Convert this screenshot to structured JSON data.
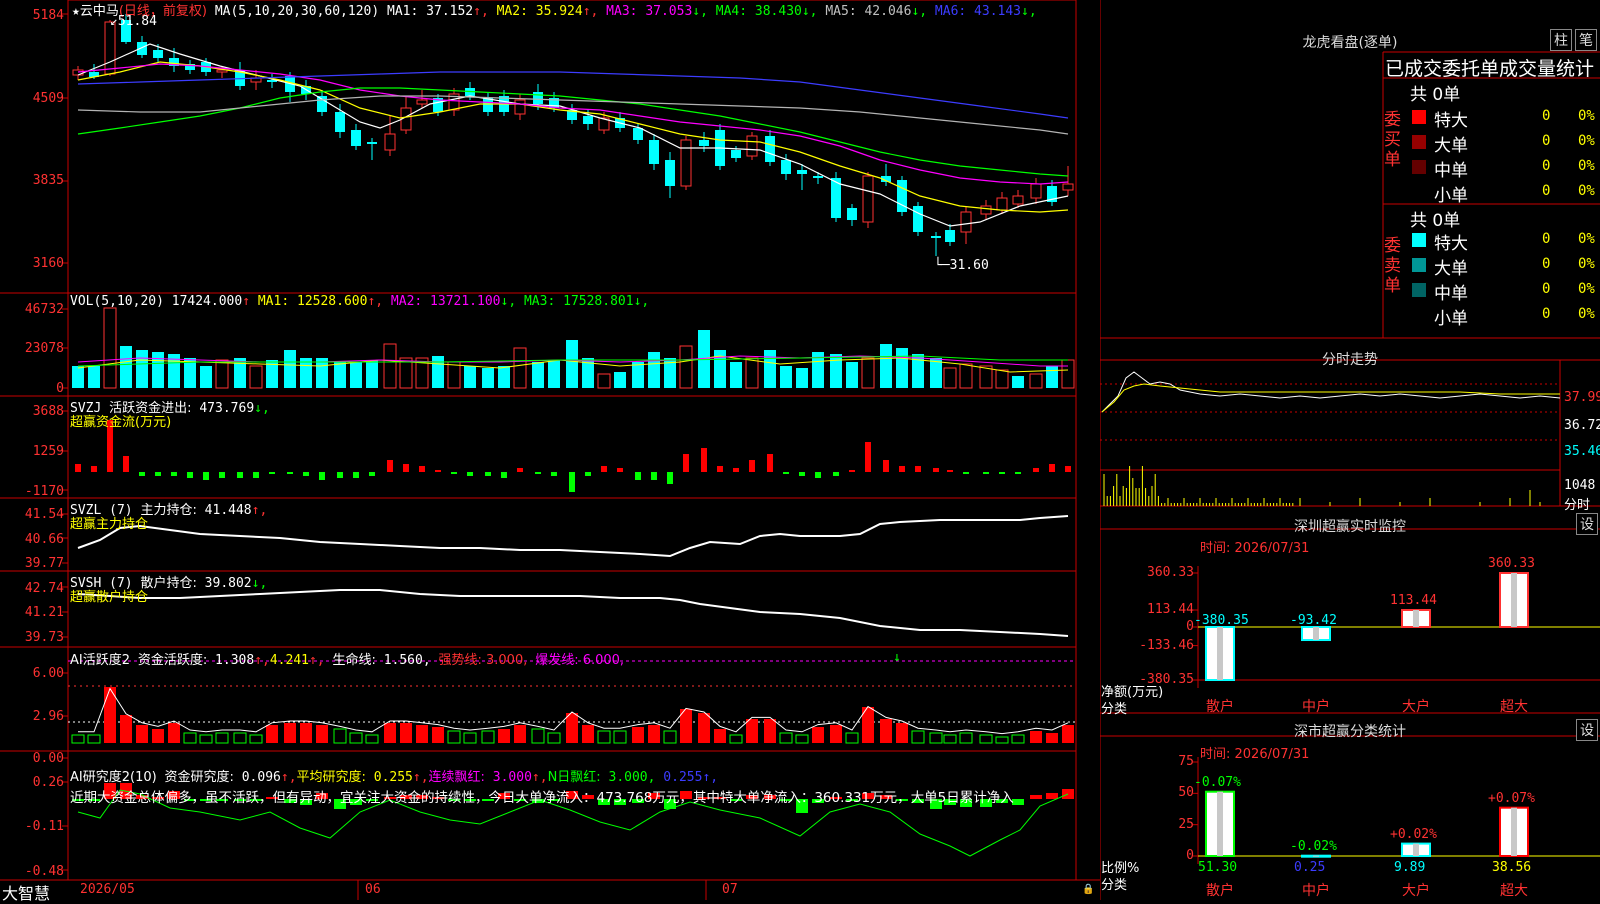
{
  "main_chart": {
    "star": "★",
    "name": "云中马",
    "mode": "(日线，前复权)",
    "ma_params": "MA(5,10,20,30,60,120)",
    "ma": [
      {
        "label": "MA1:",
        "value": "37.152",
        "dir": "↑",
        "color": "#ffffff"
      },
      {
        "label": "MA2:",
        "value": "35.924",
        "dir": "↑",
        "color": "#ffff00"
      },
      {
        "label": "MA3:",
        "value": "37.053",
        "dir": "↓",
        "color": "#ff00ff"
      },
      {
        "label": "MA4:",
        "value": "38.430",
        "dir": "↓",
        "color": "#00ff00"
      },
      {
        "label": "MA5:",
        "value": "42.046",
        "dir": "↓",
        "color": "#c0c0c0"
      },
      {
        "label": "MA6:",
        "value": "43.143",
        "dir": "↓",
        "color": "#3c3cff"
      }
    ],
    "high_mark": "51.84",
    "low_mark": "31.60",
    "y_ticks": [
      "5184",
      "4509",
      "3835",
      "3160"
    ]
  },
  "volume": {
    "params": "VOL(5,10,20)",
    "value": "17424.000",
    "dir": "↑",
    "ma": [
      {
        "label": "MA1:",
        "value": "12528.600",
        "dir": "↑",
        "color": "#ffff00"
      },
      {
        "label": "MA2:",
        "value": "13721.100",
        "dir": "↓",
        "color": "#ff00ff"
      },
      {
        "label": "MA3:",
        "value": "17528.801",
        "dir": "↓",
        "color": "#00ff00"
      }
    ],
    "y_ticks": [
      "46732",
      "23078",
      "0"
    ]
  },
  "svzj": {
    "name": "SVZJ",
    "label": "活跃资金进出:",
    "value": "473.769",
    "dir": "↓,",
    "subtitle": "超赢资金流(万元)",
    "y_ticks": [
      "3688",
      "1259",
      "-1170"
    ]
  },
  "svzl": {
    "name": "SVZL (7)",
    "label": "主力持仓:",
    "value": "41.448",
    "dir": "↑,",
    "subtitle": "超赢主力持仓",
    "y_ticks": [
      "41.54",
      "40.66",
      "39.77"
    ]
  },
  "svsh": {
    "name": "SVSH (7)",
    "label": "散户持仓:",
    "value": "39.802",
    "dir": "↓,",
    "subtitle": "超赢散户持仓",
    "y_ticks": [
      "42.74",
      "41.21",
      "39.73"
    ]
  },
  "ai_active": {
    "name": "AI活跃度2",
    "label": "资金活跃度:",
    "value": "1.308",
    "dir": "↑",
    "v2": "4.241",
    "life_label": "生命线:",
    "life": "1.560,",
    "strong": "强势线: 3.000,",
    "burst": "爆发线: 6.000,",
    "y_ticks": [
      "6.00",
      "2.96",
      "0.00"
    ]
  },
  "ai_research": {
    "name": "AI研究度2(10)",
    "label": "资金研究度:",
    "value": "0.096",
    "avg_label": "平均研究度:",
    "avg": "0.255",
    "red_label": "连续飘红:",
    "red": "3.000",
    "nred_label": "N日飘红:",
    "nred": "3.000,",
    "last": "0.255",
    "comment": "近期大资金总体偏多，虽不活跃，但有异动，宜关注大资金的持续性，今日大单净流入：473.768万元，其中特大单净流入：360.331万元，大单5日累计净入",
    "y_ticks": [
      "0.26",
      "-0.11",
      "-0.48"
    ]
  },
  "bottom": {
    "brand": "大智慧",
    "dates": [
      "2026/05",
      "06",
      "07"
    ]
  },
  "dragon": {
    "title": "龙虎看盘(逐单)",
    "btn1": "柱",
    "btn2": "笔",
    "header": "已成交委托单成交量统计",
    "buy_side": "委买单",
    "sell_side": "委卖单",
    "buy_total": "共 0单",
    "sell_total": "共 0单",
    "buy_rows": [
      {
        "name": "特大",
        "count": "0",
        "pct": "0%",
        "color": "#ff0000"
      },
      {
        "name": "大单",
        "count": "0",
        "pct": "0%",
        "color": "#960000"
      },
      {
        "name": "中单",
        "count": "0",
        "pct": "0%",
        "color": "#640000"
      },
      {
        "name": "小单",
        "count": "0",
        "pct": "0%",
        "color": ""
      }
    ],
    "sell_rows": [
      {
        "name": "特大",
        "count": "0",
        "pct": "0%",
        "color": "#00ffff"
      },
      {
        "name": "大单",
        "count": "0",
        "pct": "0%",
        "color": "#009696"
      },
      {
        "name": "中单",
        "count": "0",
        "pct": "0%",
        "color": "#006464"
      },
      {
        "name": "小单",
        "count": "0",
        "pct": "0%",
        "color": ""
      }
    ]
  },
  "intraday": {
    "title": "分时走势",
    "prices": [
      "37.99",
      "36.72",
      "35.46"
    ],
    "volume_label": "1048",
    "volume_unit": "分时"
  },
  "monitor": {
    "title": "深圳超赢实时监控",
    "set_btn": "设",
    "time": "时间: 2026/07/31",
    "y_ticks": [
      "360.33",
      "113.44",
      "0",
      "-133.46",
      "-380.35"
    ],
    "unit": "净额(万元)",
    "category_label": "分类",
    "bars": [
      {
        "cat": "散户",
        "value": -380.35,
        "label": "-380.35",
        "color": "#00ffff"
      },
      {
        "cat": "中户",
        "value": -93.42,
        "label": "-93.42",
        "color": "#00ffff"
      },
      {
        "cat": "大户",
        "value": 113.44,
        "label": "113.44",
        "color": "#ff3232"
      },
      {
        "cat": "超大",
        "value": 360.33,
        "label": "360.33",
        "color": "#ff3232"
      }
    ]
  },
  "classify": {
    "title": "深市超赢分类统计",
    "set_btn": "设",
    "time": "时间: 2026/07/31",
    "y_ticks": [
      "75",
      "50",
      "25",
      "0"
    ],
    "unit": "比例%",
    "category_label": "分类",
    "bars": [
      {
        "cat": "散户",
        "value": 51.3,
        "label": "51.30",
        "delta": "-0.07%",
        "delta_color": "#00ff00",
        "val_color": "#00ff00"
      },
      {
        "cat": "中户",
        "value": 0.25,
        "label": "0.25",
        "delta": "-0.02%",
        "delta_color": "#00ff00",
        "val_color": "#3c3cff"
      },
      {
        "cat": "大户",
        "value": 9.89,
        "label": "9.89",
        "delta": "+0.02%",
        "delta_color": "#ff3232",
        "val_color": "#00ffff"
      },
      {
        "cat": "超大",
        "value": 38.56,
        "label": "38.56",
        "delta": "+0.07%",
        "delta_color": "#ff3232",
        "val_color": "#ffff00"
      }
    ]
  }
}
